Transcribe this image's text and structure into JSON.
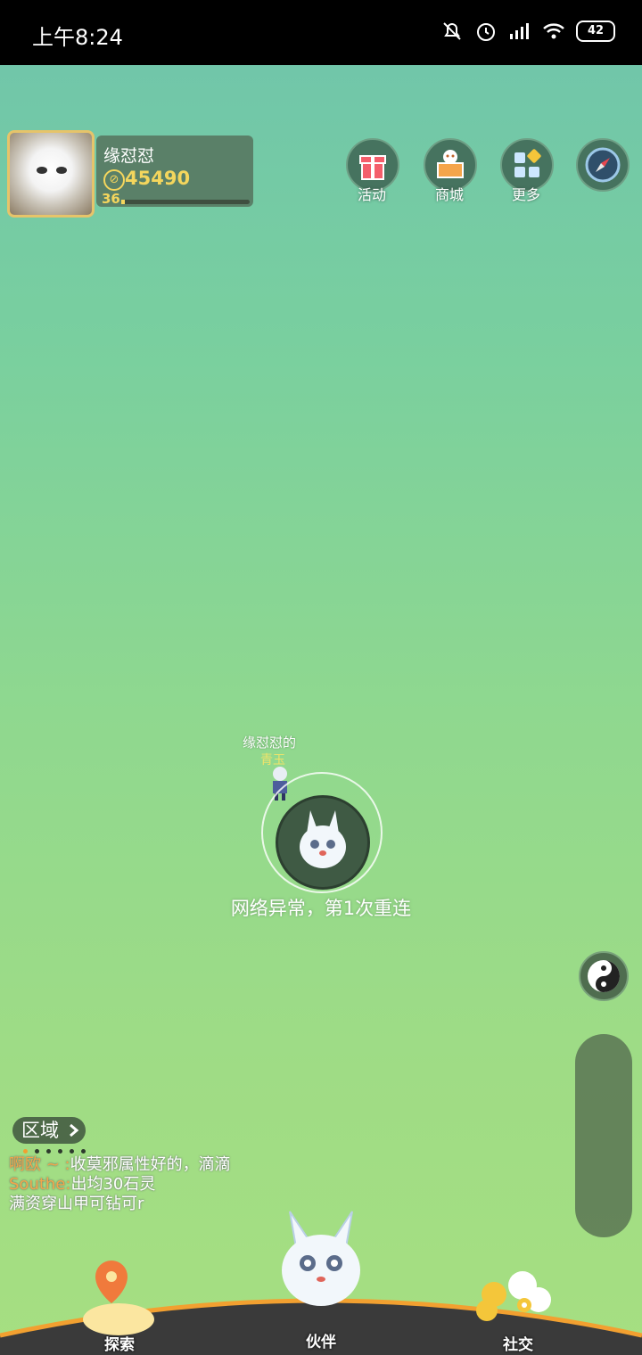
{
  "status_bar": {
    "time": "上午8:24",
    "battery": "42",
    "icons": [
      "mute-icon",
      "alarm-icon",
      "signal-icon",
      "wifi-icon",
      "battery-icon"
    ]
  },
  "profile": {
    "name": "缘怼怼",
    "coins": "45490",
    "level": "36",
    "xp_fraction": 0.03
  },
  "top_menu": [
    {
      "label": "活动",
      "icon": "gift-icon"
    },
    {
      "label": "商城",
      "icon": "shop-icon"
    },
    {
      "label": "更多",
      "icon": "more-icon"
    }
  ],
  "pet": {
    "owner_label": "缘怼怼的",
    "title": "青玉"
  },
  "reconnect_message": "网络异常，第1次重连",
  "region": {
    "label": "区域"
  },
  "chat": [
    {
      "user": "啊欧 ~ :",
      "text": "收莫邪属性好的，滴滴"
    },
    {
      "user": "Southe:",
      "text": "出均30石灵"
    },
    {
      "user": "",
      "text": "满资穿山甲可钻可r"
    }
  ],
  "bottom_nav": [
    {
      "label": "探索",
      "icon": "map-pin-icon"
    },
    {
      "label": "伙伴",
      "icon": "spirit-icon"
    },
    {
      "label": "社交",
      "icon": "flower-icon"
    }
  ],
  "colors": {
    "accent_gold": "#f4d65d",
    "bg_top": "#6fc4ac",
    "bg_bottom": "#a6df81",
    "chat_user": "#f2a64a"
  }
}
